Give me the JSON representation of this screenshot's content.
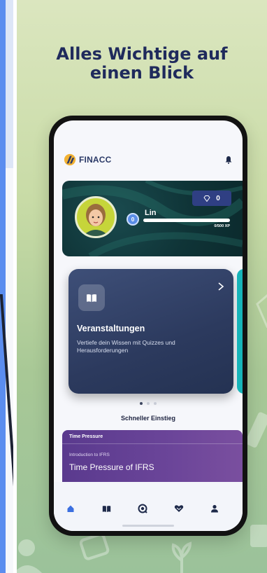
{
  "headline": {
    "line1": "Alles Wichtige auf",
    "line2": "einen Blick"
  },
  "app": {
    "name": "FINACC",
    "brand_color": "#2b3a67"
  },
  "profile": {
    "user_name": "Lin",
    "level": "0",
    "gems": "0",
    "xp_text": "0/500 XP",
    "xp_progress": 0.0
  },
  "card": {
    "title": "Veranstaltungen",
    "description": "Vertiefe dein Wissen mit Quizzes und Herausforderungen",
    "icon": "book-icon",
    "background": "#2c3a5e"
  },
  "carousel": {
    "count": 3,
    "active_index": 0
  },
  "section": {
    "title": "Schneller Einstieg"
  },
  "promo": {
    "header": "Time Pressure",
    "subtitle": "Introduction to IFRS",
    "title": "Time Pressure of IFRS"
  },
  "tabbar": {
    "items": [
      {
        "icon": "home-icon",
        "active": true
      },
      {
        "icon": "book-icon",
        "active": false
      },
      {
        "icon": "quiz-search-icon",
        "active": false
      },
      {
        "icon": "heart-hand-icon",
        "active": false
      },
      {
        "icon": "person-icon",
        "active": false
      }
    ],
    "active_color": "#3b6fe0",
    "inactive_color": "#1e2a4a"
  }
}
